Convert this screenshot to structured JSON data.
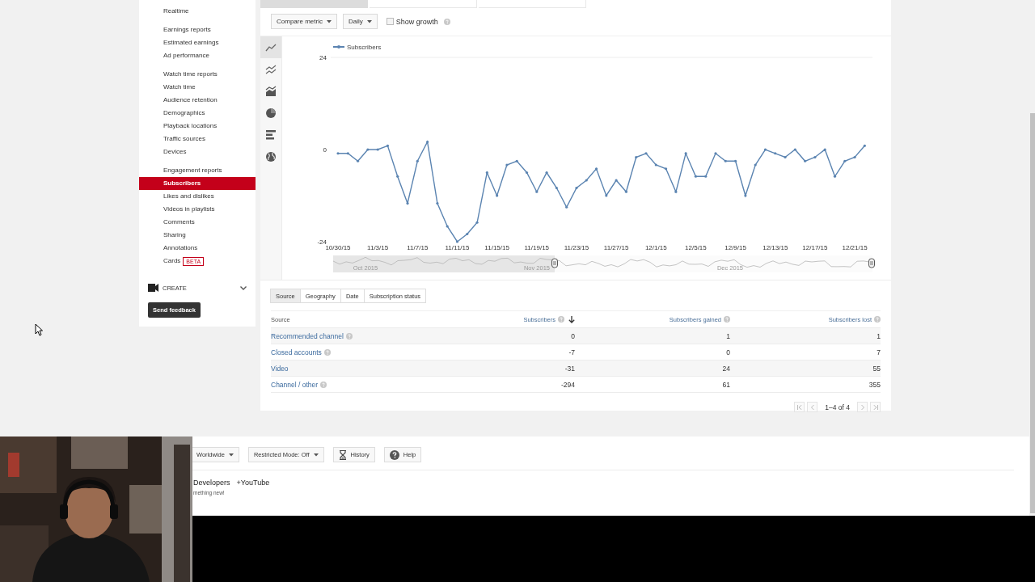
{
  "sidebar": {
    "groups": [
      {
        "items": [
          {
            "label": "Realtime",
            "selected": false
          }
        ]
      },
      {
        "items": [
          {
            "label": "Earnings reports",
            "selected": false
          },
          {
            "label": "Estimated earnings",
            "selected": false
          },
          {
            "label": "Ad performance",
            "selected": false
          }
        ]
      },
      {
        "items": [
          {
            "label": "Watch time reports",
            "selected": false
          },
          {
            "label": "Watch time",
            "selected": false
          },
          {
            "label": "Audience retention",
            "selected": false
          },
          {
            "label": "Demographics",
            "selected": false
          },
          {
            "label": "Playback locations",
            "selected": false
          },
          {
            "label": "Traffic sources",
            "selected": false
          },
          {
            "label": "Devices",
            "selected": false
          }
        ]
      },
      {
        "items": [
          {
            "label": "Engagement reports",
            "selected": false
          },
          {
            "label": "Subscribers",
            "selected": true
          },
          {
            "label": "Likes and dislikes",
            "selected": false
          },
          {
            "label": "Videos in playlists",
            "selected": false
          },
          {
            "label": "Comments",
            "selected": false
          },
          {
            "label": "Sharing",
            "selected": false
          },
          {
            "label": "Annotations",
            "selected": false
          },
          {
            "label": "Cards",
            "selected": false,
            "badge": "BETA"
          }
        ]
      }
    ],
    "create": {
      "label": "CREATE",
      "expanded": false
    },
    "feedback_button": "Send feedback"
  },
  "metric_tabs": [
    {
      "selected": true
    },
    {
      "selected": false
    },
    {
      "selected": false
    }
  ],
  "toolbar": {
    "compare_metric": "Compare metric",
    "interval": "Daily",
    "show_growth": {
      "label": "Show growth",
      "checked": false
    }
  },
  "chart_types": [
    {
      "kind": "line",
      "selected": true
    },
    {
      "kind": "multiline",
      "selected": false
    },
    {
      "kind": "area",
      "selected": false
    },
    {
      "kind": "pie",
      "selected": false
    },
    {
      "kind": "bar",
      "selected": false
    },
    {
      "kind": "map",
      "selected": false
    }
  ],
  "chart": {
    "chart_data": {
      "type": "line",
      "categories": [
        "10/30/15",
        null,
        null,
        null,
        "11/3/15",
        null,
        null,
        null,
        "11/7/15",
        null,
        null,
        null,
        "11/11/15",
        null,
        null,
        null,
        "11/15/15",
        null,
        null,
        null,
        "11/19/15",
        null,
        null,
        null,
        "11/23/15",
        null,
        null,
        null,
        "11/27/15",
        null,
        null,
        null,
        "12/1/15",
        null,
        null,
        null,
        "12/5/15",
        null,
        null,
        null,
        "12/9/15",
        null,
        null,
        null,
        "12/13/15",
        null,
        null,
        null,
        "12/17/15",
        null,
        null,
        null,
        "12/21/15",
        null
      ],
      "series": [
        {
          "name": "Subscribers",
          "color": "#5b84b1",
          "values": [
            -1,
            -1,
            -3,
            0,
            0,
            1,
            -7,
            -14,
            -3,
            2,
            -14,
            -20,
            -24,
            -22,
            -19,
            -6,
            -12,
            -4,
            -3,
            -6,
            -11,
            -6,
            -10,
            -15,
            -10,
            -8,
            -5,
            -12,
            -8,
            -11,
            -2,
            -1,
            -4,
            -5,
            -11,
            -1,
            -7,
            -7,
            -1,
            -3,
            -3,
            -12,
            -4,
            0,
            -1,
            -2,
            0,
            -3,
            -2,
            0,
            -7,
            -3,
            -2,
            1
          ]
        }
      ],
      "ylim": [
        -24,
        24
      ],
      "yticks": [
        -24,
        0,
        24
      ]
    },
    "navigator": {
      "labels": [
        "Oct 2015",
        "Nov 2015",
        "Dec 2015"
      ]
    }
  },
  "table": {
    "tabs": [
      {
        "label": "Source",
        "selected": true
      },
      {
        "label": "Geography",
        "selected": false
      },
      {
        "label": "Date",
        "selected": false
      },
      {
        "label": "Subscription status",
        "selected": false
      }
    ],
    "columns": [
      {
        "label": "Source",
        "help": false,
        "sorted": false
      },
      {
        "label": "Subscribers",
        "help": true,
        "sorted": true
      },
      {
        "label": "Subscribers gained",
        "help": true,
        "sorted": false
      },
      {
        "label": "Subscribers lost",
        "help": true,
        "sorted": false
      }
    ],
    "rows": [
      {
        "source": "Recommended channel",
        "help": true,
        "values": [
          "0",
          "1",
          "1"
        ]
      },
      {
        "source": "Closed accounts",
        "help": true,
        "values": [
          "-7",
          "0",
          "7"
        ]
      },
      {
        "source": "Video",
        "help": false,
        "values": [
          "-31",
          "24",
          "55"
        ]
      },
      {
        "source": "Channel / other",
        "help": true,
        "values": [
          "-294",
          "61",
          "355"
        ]
      }
    ],
    "pagination": "1–4 of 4"
  },
  "footer": {
    "buttons": [
      {
        "kind": "dropdown",
        "label": "Worldwide"
      },
      {
        "kind": "dropdown",
        "label": "Restricted Mode: Off"
      },
      {
        "kind": "history",
        "label": "History"
      },
      {
        "kind": "help",
        "label": "Help"
      }
    ],
    "links": [
      "Developers",
      "+YouTube"
    ],
    "note": "mething new!"
  }
}
